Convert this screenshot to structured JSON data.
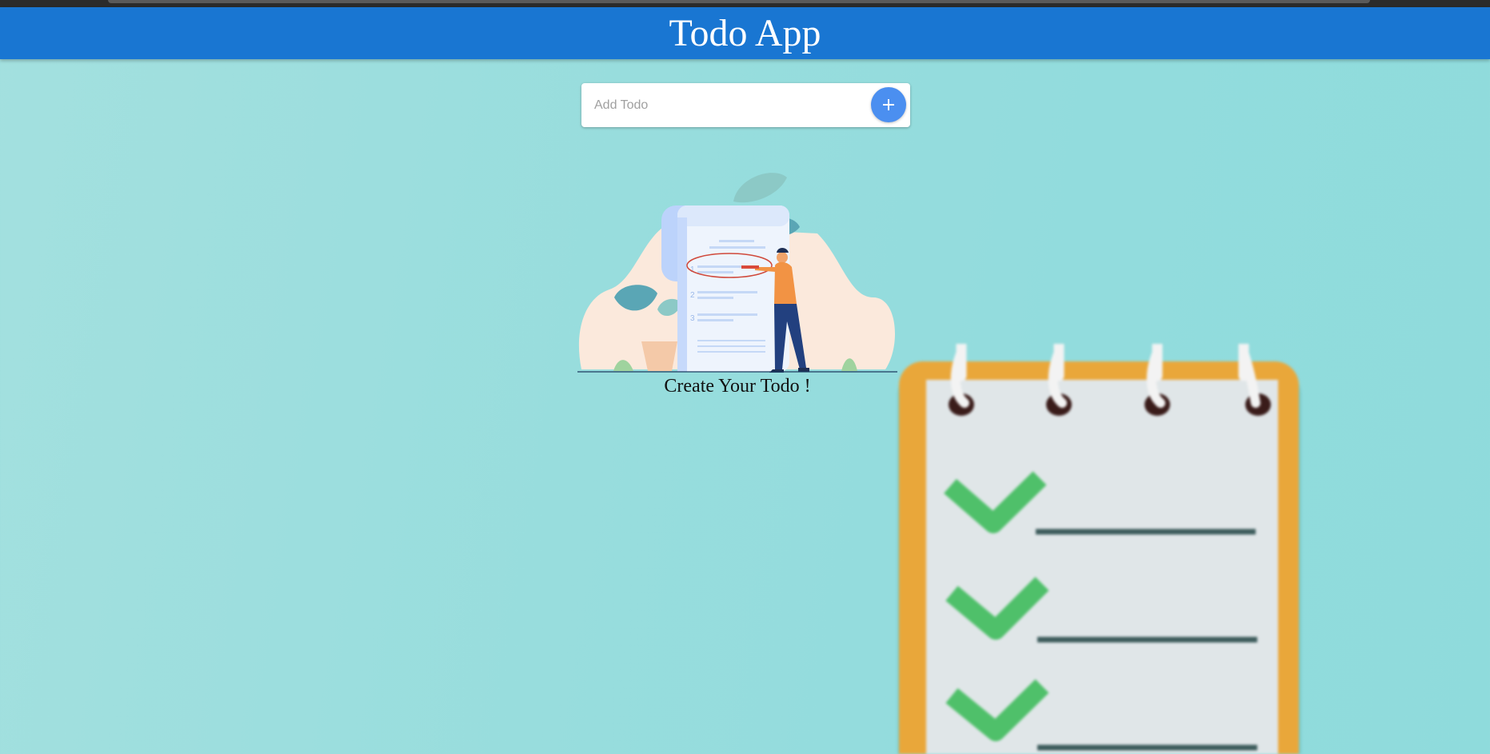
{
  "app": {
    "title": "Todo App"
  },
  "add_todo": {
    "placeholder": "Add Todo",
    "value": "",
    "button_icon": "plus-icon"
  },
  "empty_state": {
    "message": "Create Your Todo !"
  },
  "colors": {
    "appbar": "#1976d2",
    "add_button": "#4b8ff0",
    "background": "#95dcdc"
  }
}
